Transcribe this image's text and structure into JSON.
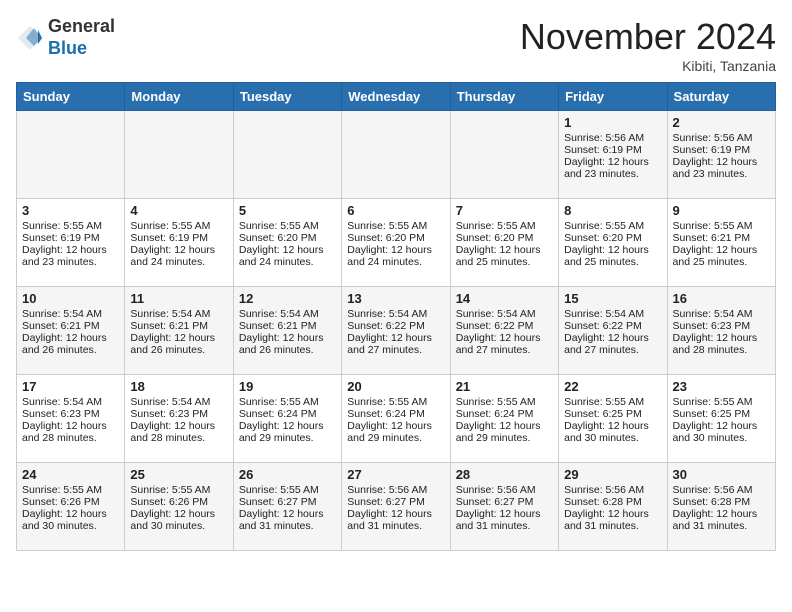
{
  "header": {
    "logo_line1": "General",
    "logo_line2": "Blue",
    "month_title": "November 2024",
    "location": "Kibiti, Tanzania"
  },
  "days_of_week": [
    "Sunday",
    "Monday",
    "Tuesday",
    "Wednesday",
    "Thursday",
    "Friday",
    "Saturday"
  ],
  "weeks": [
    [
      {
        "day": "",
        "info": ""
      },
      {
        "day": "",
        "info": ""
      },
      {
        "day": "",
        "info": ""
      },
      {
        "day": "",
        "info": ""
      },
      {
        "day": "",
        "info": ""
      },
      {
        "day": "1",
        "info": "Sunrise: 5:56 AM\nSunset: 6:19 PM\nDaylight: 12 hours and 23 minutes."
      },
      {
        "day": "2",
        "info": "Sunrise: 5:56 AM\nSunset: 6:19 PM\nDaylight: 12 hours and 23 minutes."
      }
    ],
    [
      {
        "day": "3",
        "info": "Sunrise: 5:55 AM\nSunset: 6:19 PM\nDaylight: 12 hours and 23 minutes."
      },
      {
        "day": "4",
        "info": "Sunrise: 5:55 AM\nSunset: 6:19 PM\nDaylight: 12 hours and 24 minutes."
      },
      {
        "day": "5",
        "info": "Sunrise: 5:55 AM\nSunset: 6:20 PM\nDaylight: 12 hours and 24 minutes."
      },
      {
        "day": "6",
        "info": "Sunrise: 5:55 AM\nSunset: 6:20 PM\nDaylight: 12 hours and 24 minutes."
      },
      {
        "day": "7",
        "info": "Sunrise: 5:55 AM\nSunset: 6:20 PM\nDaylight: 12 hours and 25 minutes."
      },
      {
        "day": "8",
        "info": "Sunrise: 5:55 AM\nSunset: 6:20 PM\nDaylight: 12 hours and 25 minutes."
      },
      {
        "day": "9",
        "info": "Sunrise: 5:55 AM\nSunset: 6:21 PM\nDaylight: 12 hours and 25 minutes."
      }
    ],
    [
      {
        "day": "10",
        "info": "Sunrise: 5:54 AM\nSunset: 6:21 PM\nDaylight: 12 hours and 26 minutes."
      },
      {
        "day": "11",
        "info": "Sunrise: 5:54 AM\nSunset: 6:21 PM\nDaylight: 12 hours and 26 minutes."
      },
      {
        "day": "12",
        "info": "Sunrise: 5:54 AM\nSunset: 6:21 PM\nDaylight: 12 hours and 26 minutes."
      },
      {
        "day": "13",
        "info": "Sunrise: 5:54 AM\nSunset: 6:22 PM\nDaylight: 12 hours and 27 minutes."
      },
      {
        "day": "14",
        "info": "Sunrise: 5:54 AM\nSunset: 6:22 PM\nDaylight: 12 hours and 27 minutes."
      },
      {
        "day": "15",
        "info": "Sunrise: 5:54 AM\nSunset: 6:22 PM\nDaylight: 12 hours and 27 minutes."
      },
      {
        "day": "16",
        "info": "Sunrise: 5:54 AM\nSunset: 6:23 PM\nDaylight: 12 hours and 28 minutes."
      }
    ],
    [
      {
        "day": "17",
        "info": "Sunrise: 5:54 AM\nSunset: 6:23 PM\nDaylight: 12 hours and 28 minutes."
      },
      {
        "day": "18",
        "info": "Sunrise: 5:54 AM\nSunset: 6:23 PM\nDaylight: 12 hours and 28 minutes."
      },
      {
        "day": "19",
        "info": "Sunrise: 5:55 AM\nSunset: 6:24 PM\nDaylight: 12 hours and 29 minutes."
      },
      {
        "day": "20",
        "info": "Sunrise: 5:55 AM\nSunset: 6:24 PM\nDaylight: 12 hours and 29 minutes."
      },
      {
        "day": "21",
        "info": "Sunrise: 5:55 AM\nSunset: 6:24 PM\nDaylight: 12 hours and 29 minutes."
      },
      {
        "day": "22",
        "info": "Sunrise: 5:55 AM\nSunset: 6:25 PM\nDaylight: 12 hours and 30 minutes."
      },
      {
        "day": "23",
        "info": "Sunrise: 5:55 AM\nSunset: 6:25 PM\nDaylight: 12 hours and 30 minutes."
      }
    ],
    [
      {
        "day": "24",
        "info": "Sunrise: 5:55 AM\nSunset: 6:26 PM\nDaylight: 12 hours and 30 minutes."
      },
      {
        "day": "25",
        "info": "Sunrise: 5:55 AM\nSunset: 6:26 PM\nDaylight: 12 hours and 30 minutes."
      },
      {
        "day": "26",
        "info": "Sunrise: 5:55 AM\nSunset: 6:27 PM\nDaylight: 12 hours and 31 minutes."
      },
      {
        "day": "27",
        "info": "Sunrise: 5:56 AM\nSunset: 6:27 PM\nDaylight: 12 hours and 31 minutes."
      },
      {
        "day": "28",
        "info": "Sunrise: 5:56 AM\nSunset: 6:27 PM\nDaylight: 12 hours and 31 minutes."
      },
      {
        "day": "29",
        "info": "Sunrise: 5:56 AM\nSunset: 6:28 PM\nDaylight: 12 hours and 31 minutes."
      },
      {
        "day": "30",
        "info": "Sunrise: 5:56 AM\nSunset: 6:28 PM\nDaylight: 12 hours and 31 minutes."
      }
    ]
  ]
}
